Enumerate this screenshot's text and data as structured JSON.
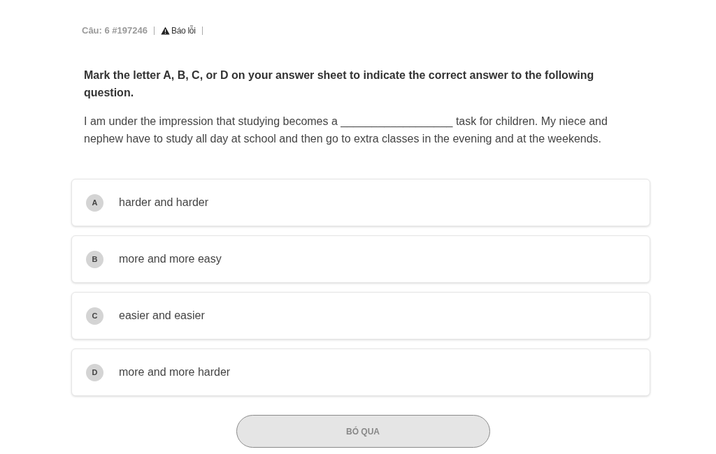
{
  "question_header": {
    "label": "Câu: 6 #197246",
    "report_link": "Báo lỗi"
  },
  "instruction": "Mark the letter A, B, C, or D on your answer sheet to indicate the correct answer to the following question.",
  "question": "I am under the impression that studying becomes a __________________ task for children. My niece and nephew have to study all day at school and then go to extra classes in the evening and at the weekends.",
  "options": [
    {
      "letter": "A",
      "text": "harder and harder",
      "selected": false
    },
    {
      "letter": "B",
      "text": "more and more easy",
      "selected": false
    },
    {
      "letter": "C",
      "text": "easier and easier",
      "selected": false
    },
    {
      "letter": "D",
      "text": "more and more harder",
      "selected": false
    }
  ],
  "skip_button": "BÓ QUA"
}
